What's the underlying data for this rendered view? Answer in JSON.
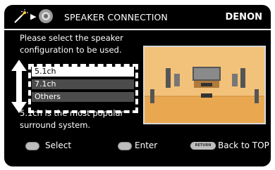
{
  "header": {
    "title": "SPEAKER CONNECTION",
    "brand": "DENON"
  },
  "instruction": "Please select the speaker configuration to be used.",
  "options": [
    {
      "label": "5.1ch",
      "selected": true
    },
    {
      "label": "7.1ch",
      "selected": false
    },
    {
      "label": "Others",
      "selected": false
    }
  ],
  "description": "5.1ch is the most popular surround system.",
  "footer": {
    "select_label": "Select",
    "enter_label": "Enter",
    "return_label": "RETURN",
    "back_label": "Back to TOP"
  },
  "colors": {
    "background": "#000000",
    "text": "#ffffff",
    "room_wall": "#f2c27a",
    "room_floor": "#e9a850"
  }
}
